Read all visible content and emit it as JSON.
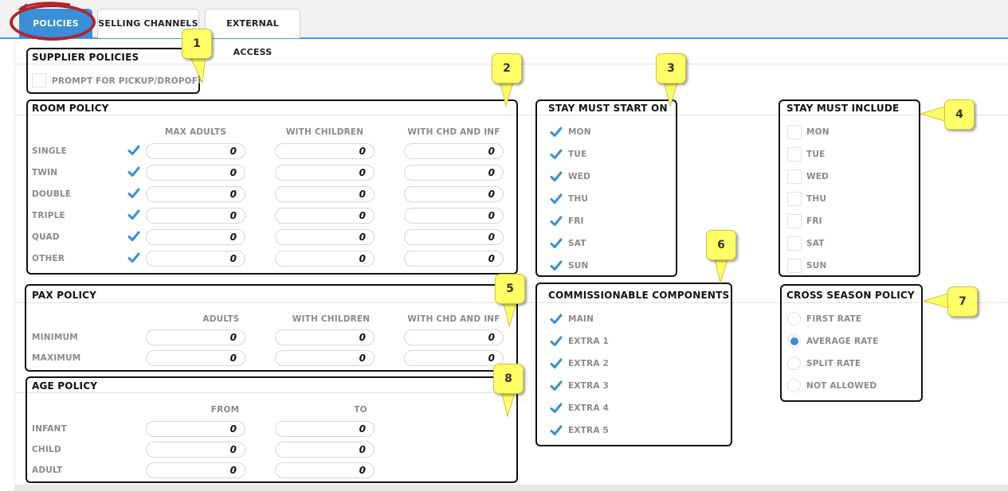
{
  "tabs": [
    {
      "label": "POLICIES",
      "active": true
    },
    {
      "label": "SELLING CHANNELS",
      "active": false
    },
    {
      "label": "EXTERNAL ACCESS",
      "active": false
    }
  ],
  "callouts": [
    "1",
    "2",
    "3",
    "4",
    "5",
    "6",
    "7",
    "8"
  ],
  "supplier": {
    "title": "SUPPLIER POLICIES",
    "prompt_label": "PROMPT FOR PICKUP/DROPOFF"
  },
  "room": {
    "title": "ROOM POLICY",
    "headers": [
      "MAX ADULTS",
      "WITH CHILDREN",
      "WITH CHD AND INF"
    ],
    "rows": [
      {
        "label": "SINGLE",
        "values": [
          "0",
          "0",
          "0"
        ]
      },
      {
        "label": "TWIN",
        "values": [
          "0",
          "0",
          "0"
        ]
      },
      {
        "label": "DOUBLE",
        "values": [
          "0",
          "0",
          "0"
        ]
      },
      {
        "label": "TRIPLE",
        "values": [
          "0",
          "0",
          "0"
        ]
      },
      {
        "label": "QUAD",
        "values": [
          "0",
          "0",
          "0"
        ]
      },
      {
        "label": "OTHER",
        "values": [
          "0",
          "0",
          "0"
        ]
      }
    ]
  },
  "start": {
    "title": "STAY MUST START ON",
    "days": [
      "MON",
      "TUE",
      "WED",
      "THU",
      "FRI",
      "SAT",
      "SUN"
    ]
  },
  "include": {
    "title": "STAY MUST INCLUDE",
    "days": [
      "MON",
      "TUE",
      "WED",
      "THU",
      "FRI",
      "SAT",
      "SUN"
    ]
  },
  "pax": {
    "title": "PAX POLICY",
    "headers": [
      "ADULTS",
      "WITH CHILDREN",
      "WITH CHD AND INF"
    ],
    "rows": [
      {
        "label": "MINIMUM",
        "values": [
          "0",
          "0",
          "0"
        ]
      },
      {
        "label": "MAXIMUM",
        "values": [
          "0",
          "0",
          "0"
        ]
      }
    ]
  },
  "commission": {
    "title": "COMMISSIONABLE COMPONENTS",
    "items": [
      "MAIN",
      "EXTRA 1",
      "EXTRA 2",
      "EXTRA 3",
      "EXTRA 4",
      "EXTRA 5"
    ]
  },
  "cross": {
    "title": "CROSS SEASON POLICY",
    "options": [
      "FIRST RATE",
      "AVERAGE RATE",
      "SPLIT RATE",
      "NOT ALLOWED"
    ],
    "selected": "AVERAGE RATE"
  },
  "age": {
    "title": "AGE POLICY",
    "headers": [
      "FROM",
      "TO"
    ],
    "rows": [
      {
        "label": "INFANT",
        "values": [
          "0",
          "0"
        ]
      },
      {
        "label": "CHILD",
        "values": [
          "0",
          "0"
        ]
      },
      {
        "label": "ADULT",
        "values": [
          "0",
          "0"
        ]
      }
    ]
  },
  "colors": {
    "accent": "#3a8fd8",
    "callout": "#ffff66",
    "highlight_ring": "#b3232a"
  }
}
